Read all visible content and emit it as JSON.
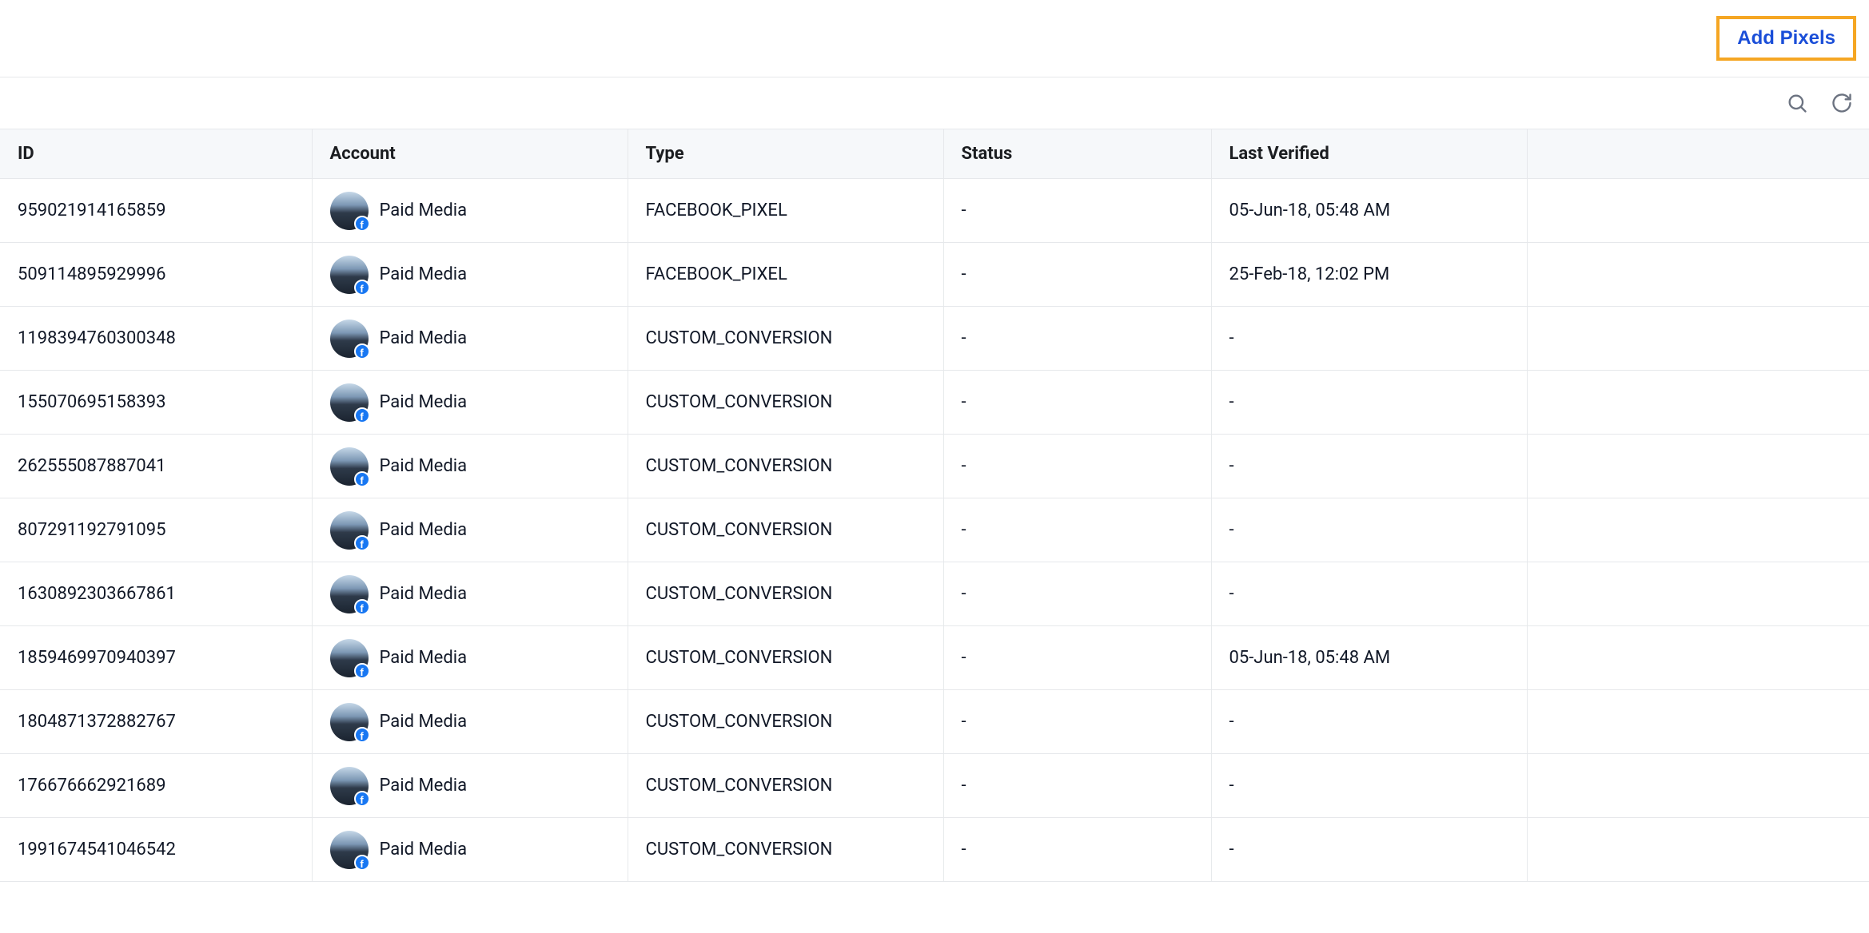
{
  "header": {
    "add_pixels_label": "Add Pixels"
  },
  "columns": {
    "id": "ID",
    "account": "Account",
    "type": "Type",
    "status": "Status",
    "last_verified": "Last Verified"
  },
  "rows": [
    {
      "id": "959021914165859",
      "account_name": "Paid Media",
      "platform_icon": "facebook",
      "type": "FACEBOOK_PIXEL",
      "status": "-",
      "last_verified": "05-Jun-18, 05:48 AM"
    },
    {
      "id": "509114895929996",
      "account_name": "Paid Media",
      "platform_icon": "facebook",
      "type": "FACEBOOK_PIXEL",
      "status": "-",
      "last_verified": "25-Feb-18, 12:02 PM"
    },
    {
      "id": "1198394760300348",
      "account_name": "Paid Media",
      "platform_icon": "facebook",
      "type": "CUSTOM_CONVERSION",
      "status": "-",
      "last_verified": "-"
    },
    {
      "id": "155070695158393",
      "account_name": "Paid Media",
      "platform_icon": "facebook",
      "type": "CUSTOM_CONVERSION",
      "status": "-",
      "last_verified": "-"
    },
    {
      "id": "262555087887041",
      "account_name": "Paid Media",
      "platform_icon": "facebook",
      "type": "CUSTOM_CONVERSION",
      "status": "-",
      "last_verified": "-"
    },
    {
      "id": "807291192791095",
      "account_name": "Paid Media",
      "platform_icon": "facebook",
      "type": "CUSTOM_CONVERSION",
      "status": "-",
      "last_verified": "-"
    },
    {
      "id": "1630892303667861",
      "account_name": "Paid Media",
      "platform_icon": "facebook",
      "type": "CUSTOM_CONVERSION",
      "status": "-",
      "last_verified": "-"
    },
    {
      "id": "1859469970940397",
      "account_name": "Paid Media",
      "platform_icon": "facebook",
      "type": "CUSTOM_CONVERSION",
      "status": "-",
      "last_verified": "05-Jun-18, 05:48 AM"
    },
    {
      "id": "1804871372882767",
      "account_name": "Paid Media",
      "platform_icon": "facebook",
      "type": "CUSTOM_CONVERSION",
      "status": "-",
      "last_verified": "-"
    },
    {
      "id": "176676662921689",
      "account_name": "Paid Media",
      "platform_icon": "facebook",
      "type": "CUSTOM_CONVERSION",
      "status": "-",
      "last_verified": "-"
    },
    {
      "id": "1991674541046542",
      "account_name": "Paid Media",
      "platform_icon": "facebook",
      "type": "CUSTOM_CONVERSION",
      "status": "-",
      "last_verified": "-"
    }
  ]
}
